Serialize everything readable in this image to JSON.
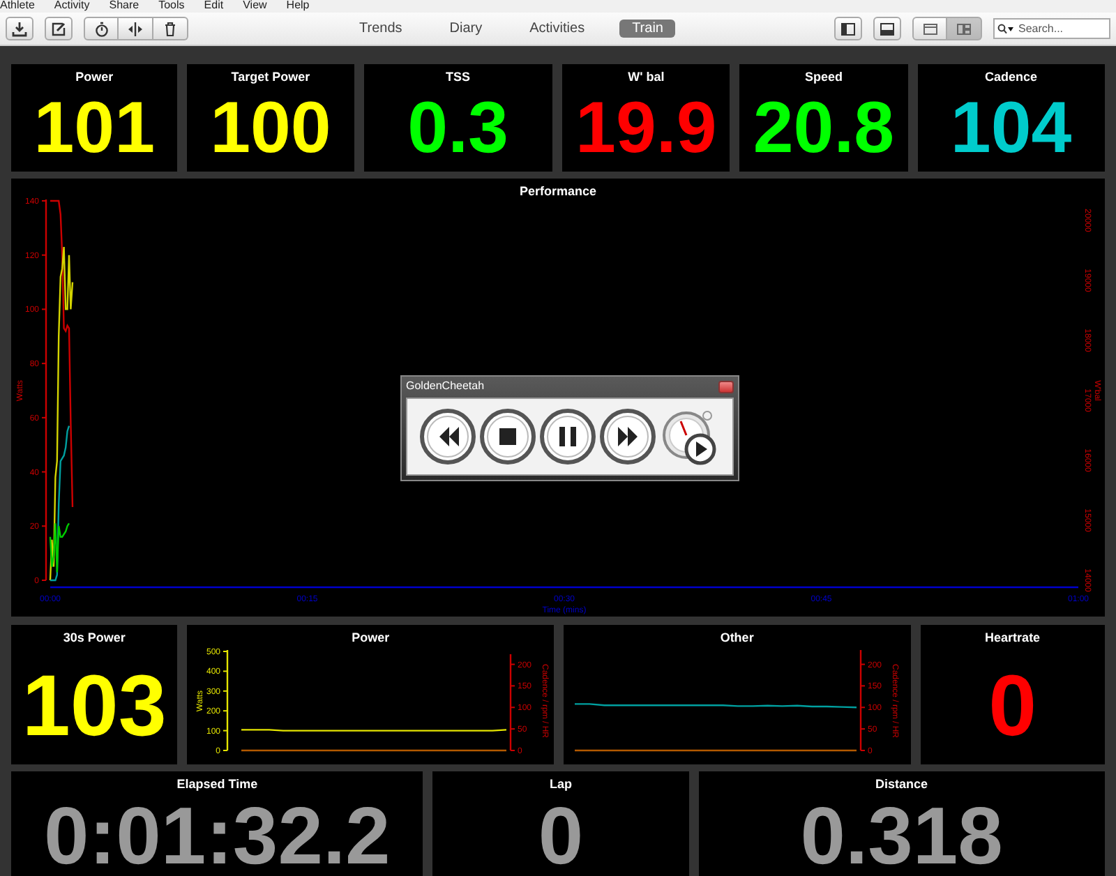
{
  "menu": [
    "Athlete",
    "Activity",
    "Share",
    "Tools",
    "Edit",
    "View",
    "Help"
  ],
  "nav_tabs": [
    {
      "label": "Trends",
      "selected": false
    },
    {
      "label": "Diary",
      "selected": false
    },
    {
      "label": "Activities",
      "selected": false
    },
    {
      "label": "Train",
      "selected": true
    }
  ],
  "layout_toggle": [
    {
      "selected": false
    },
    {
      "selected": true
    }
  ],
  "search": {
    "placeholder": "Search..."
  },
  "rows": [
    {
      "tiles": [
        {
          "kind": "value",
          "label": "Power",
          "value": "101",
          "color": "#ffff00"
        },
        {
          "kind": "value",
          "label": "Target Power",
          "value": "100",
          "color": "#ffff00"
        },
        {
          "kind": "value",
          "label": "TSS",
          "value": "0.3",
          "color": "#00ff00"
        },
        {
          "kind": "value",
          "label": "W' bal",
          "value": "19.9",
          "color": "#ff0000"
        },
        {
          "kind": "value",
          "label": "Speed",
          "value": "20.8",
          "color": "#00ff00"
        },
        {
          "kind": "value",
          "label": "Cadence",
          "value": "104",
          "color": "#00cccc"
        }
      ]
    },
    {
      "tiles": [
        {
          "kind": "chart",
          "label": "Performance",
          "chart_data": {
            "type": "line",
            "xlabel": "Time (mins)",
            "ylabel": "Watts",
            "y2label": "W'bal",
            "x": [
              0,
              0.1,
              0.2,
              0.3,
              0.4,
              0.5,
              0.6,
              0.7,
              0.8,
              0.9,
              1.0,
              1.1,
              1.2,
              1.3
            ],
            "xlim": [
              0,
              60
            ],
            "ylim": [
              0,
              140
            ],
            "xticks": [
              {
                "value": 0,
                "label": "00:00"
              },
              {
                "value": 15,
                "label": "00:15"
              },
              {
                "value": 30,
                "label": "00:30"
              },
              {
                "value": 45,
                "label": "00:45"
              },
              {
                "value": 60,
                "label": "01:00"
              }
            ],
            "yticks": [
              0,
              20,
              40,
              60,
              80,
              100,
              120,
              140
            ],
            "y2ticks": [
              "20000",
              "19000",
              "18000",
              "17000",
              "16000",
              "15000",
              "14000"
            ],
            "series": [
              {
                "color": "#cc0000",
                "values": [
                  140,
                  140,
                  140,
                  140,
                  140,
                  140,
                  135,
                  120,
                  93,
                  92,
                  94,
                  93,
                  58,
                  27
                ]
              },
              {
                "color": "#d4d400",
                "values": [
                  0,
                  15,
                  5,
                  38,
                  44,
                  90,
                  112,
                  115,
                  123,
                  100,
                  100,
                  120,
                  100,
                  110
                ]
              },
              {
                "color": "#00a0a0",
                "values": [
                  0,
                  0,
                  0,
                  0,
                  2,
                  28,
                  44,
                  45,
                  46,
                  49,
                  55,
                  57,
                  null,
                  null
                ]
              },
              {
                "color": "#00cc00",
                "values": [
                  16,
                  5,
                  9,
                  21,
                  3,
                  20,
                  16,
                  16,
                  17,
                  18,
                  20,
                  21,
                  null,
                  null
                ]
              }
            ]
          }
        }
      ]
    },
    {
      "tiles": [
        {
          "kind": "value",
          "label": "30s Power",
          "value": "103",
          "color": "#ffff00"
        },
        {
          "kind": "chart",
          "label": "Power",
          "chart_data": {
            "type": "line",
            "ylabel": "Watts",
            "y2label": "Cadence / rpm / HR",
            "ylim": [
              0,
              500
            ],
            "yticks": [
              0,
              100,
              200,
              300,
              400,
              500
            ],
            "y2ticks": [
              "0",
              "50",
              "100",
              "150",
              "200"
            ],
            "series": [
              {
                "color": "#e5e500",
                "values": [
                  104,
                  104,
                  104,
                  100,
                  100,
                  100,
                  100,
                  100,
                  100,
                  100,
                  100,
                  100,
                  100,
                  100,
                  100,
                  100,
                  100,
                  100,
                  100,
                  104
                ]
              },
              {
                "color": "#b35900",
                "values": [
                  0,
                  0,
                  0,
                  0,
                  0,
                  0,
                  0,
                  0,
                  0,
                  0,
                  0,
                  0,
                  0,
                  0,
                  0,
                  0,
                  0,
                  0,
                  0,
                  0
                ]
              }
            ]
          }
        },
        {
          "kind": "chart",
          "label": "Other",
          "chart_data": {
            "type": "line",
            "ylabel": "Cadence / rpm / HR",
            "ylim": [
              0,
              230
            ],
            "yticks": [
              0,
              50,
              100,
              150,
              200
            ],
            "series": [
              {
                "color": "#00a0a0",
                "values": [
                  108,
                  108,
                  105,
                  105,
                  105,
                  105,
                  105,
                  105,
                  105,
                  105,
                  105,
                  103,
                  103,
                  104,
                  103,
                  104,
                  102,
                  102,
                  101,
                  100
                ]
              },
              {
                "color": "#b35900",
                "values": [
                  0,
                  0,
                  0,
                  0,
                  0,
                  0,
                  0,
                  0,
                  0,
                  0,
                  0,
                  0,
                  0,
                  0,
                  0,
                  0,
                  0,
                  0,
                  0,
                  0
                ]
              }
            ]
          }
        },
        {
          "kind": "value",
          "label": "Heartrate",
          "value": "0",
          "color": "#ff0000"
        }
      ]
    },
    {
      "tiles": [
        {
          "kind": "value",
          "label": "Elapsed Time",
          "value": "0:01:32.2",
          "color": "#999999"
        },
        {
          "kind": "value",
          "label": "Lap",
          "value": "0",
          "color": "#999999"
        },
        {
          "kind": "value",
          "label": "Distance",
          "value": "0.318",
          "color": "#999999"
        }
      ]
    }
  ],
  "dialog": {
    "title": "GoldenCheetah"
  }
}
